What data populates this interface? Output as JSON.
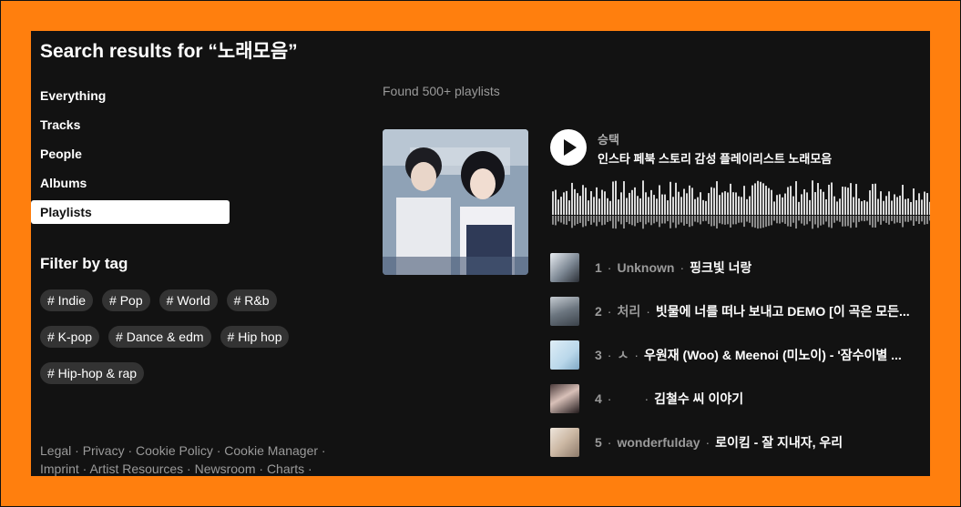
{
  "search": {
    "title": "Search results for “노래모음”"
  },
  "nav": {
    "items": [
      {
        "label": "Everything"
      },
      {
        "label": "Tracks"
      },
      {
        "label": "People"
      },
      {
        "label": "Albums"
      },
      {
        "label": "Playlists"
      }
    ],
    "active": "Playlists"
  },
  "filter": {
    "title": "Filter by tag",
    "tags": [
      "# Indie",
      "# Pop",
      "# World",
      "# R&b",
      "# K-pop",
      "# Dance & edm",
      "# Hip hop",
      "# Hip-hop & rap"
    ]
  },
  "footer": {
    "line1": "Legal · Privacy · Cookie Policy · Cookie Manager ·",
    "line2": "Imprint · Artist Resources · Newsroom · Charts ·"
  },
  "results": {
    "found": "Found 500+ playlists"
  },
  "playlist": {
    "uploader": "승택",
    "title": "인스타 페북 스토리 감성 플레이리스트 노래모음",
    "tracks": [
      {
        "num": "1",
        "user": "Unknown",
        "name": "핑크빛 너랑"
      },
      {
        "num": "2",
        "user": "처리",
        "name": "빗물에 너를 떠나 보내고 DEMO [이 곡은 모든..."
      },
      {
        "num": "3",
        "user": "ㅅ",
        "name": "우원재 (Woo) & Meenoi (미노이) - '잠수이별 ..."
      },
      {
        "num": "4",
        "user": "",
        "name": "김철수 씨 이야기"
      },
      {
        "num": "5",
        "user": "wonderfulday",
        "name": "로이킴 - 잘 지내자, 우리"
      }
    ]
  },
  "colors": {
    "accent": "#ff7f0e",
    "panel": "#121212",
    "muted": "#9a9a9a"
  }
}
